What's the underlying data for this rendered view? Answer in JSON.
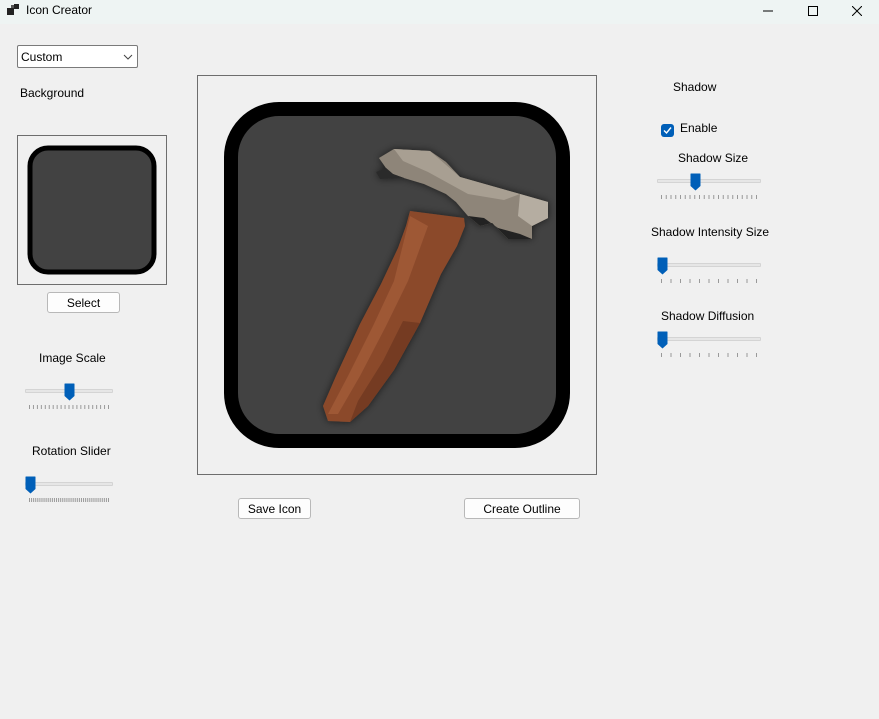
{
  "window": {
    "title": "Icon Creator",
    "minimize_icon": "minimize-icon",
    "maximize_icon": "maximize-icon",
    "close_icon": "close-icon"
  },
  "left_panel": {
    "preset_dropdown": {
      "selected": "Custom"
    },
    "background_label": "Background",
    "background_preview": {
      "frame_color": "#000000",
      "fill_color": "#424242"
    },
    "select_button": "Select",
    "image_scale": {
      "label": "Image Scale",
      "value_fraction": 0.5
    },
    "rotation": {
      "label": "Rotation Slider",
      "value_fraction": 0.0
    }
  },
  "center_panel": {
    "preview_icon": "hammer-icon",
    "frame_color": "#000000",
    "fill_color": "#424242",
    "save_button": "Save Icon",
    "outline_button": "Create Outline"
  },
  "right_panel": {
    "shadow_heading": "Shadow",
    "enable": {
      "label": "Enable",
      "checked": true
    },
    "shadow_size": {
      "label": "Shadow Size",
      "value_fraction": 0.35
    },
    "shadow_intensity": {
      "label": "Shadow Intensity Size",
      "value_fraction": 0.0
    },
    "shadow_diffusion": {
      "label": "Shadow Diffusion",
      "value_fraction": 0.0
    }
  },
  "colors": {
    "accent": "#005fb8",
    "window_bg": "#f0f0f0",
    "titlebar_bg": "#eef4f3",
    "hammer_head": "#8e8579",
    "hammer_handle": "#8b4a2c"
  }
}
